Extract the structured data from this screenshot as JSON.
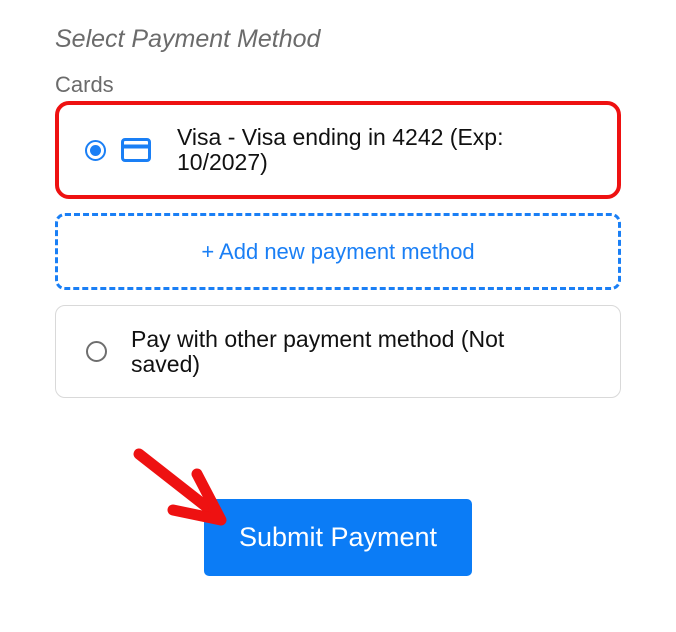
{
  "payment": {
    "title": "Select Payment Method",
    "cards_label": "Cards",
    "saved_card": {
      "label": "Visa - Visa ending in 4242 (Exp: 10/2027)",
      "selected": true,
      "icon": "credit-card-icon"
    },
    "add_new_label": "+ Add new payment method",
    "other_option": {
      "label": "Pay with other payment method (Not saved)",
      "selected": false
    },
    "submit_label": "Submit Payment"
  },
  "colors": {
    "accent": "#1a7ff5",
    "submit_bg": "#0b7cf6",
    "highlight": "#ee1111",
    "muted_text": "#6b6b6b"
  },
  "icons": {
    "saved_card": "credit-card-icon",
    "annotation": "red-pointer-arrow-icon"
  }
}
